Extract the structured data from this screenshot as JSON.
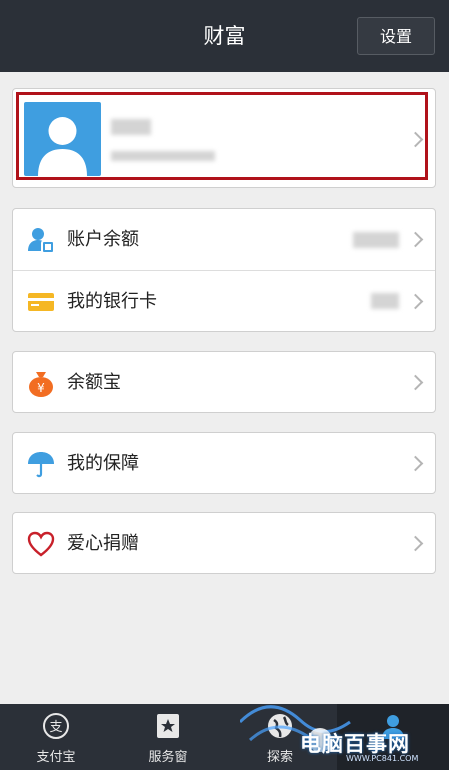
{
  "header": {
    "title": "财富",
    "settings_label": "设置"
  },
  "profile": {
    "name": "",
    "account": ""
  },
  "menu": {
    "balance_label": "账户余额",
    "bankcard_label": "我的银行卡",
    "yuebao_label": "余额宝",
    "insurance_label": "我的保障",
    "charity_label": "爱心捐赠"
  },
  "tabs": [
    {
      "label": "支付宝"
    },
    {
      "label": "服务窗"
    },
    {
      "label": "探索"
    },
    {
      "label": ""
    }
  ],
  "watermark": {
    "text": "电脑百事网",
    "url": "WWW.PC841.COM"
  },
  "colors": {
    "header_bg": "#2b3038",
    "highlight": "#b0121a",
    "accent_blue": "#3f9ee0",
    "yuebao_orange": "#f26d22"
  }
}
